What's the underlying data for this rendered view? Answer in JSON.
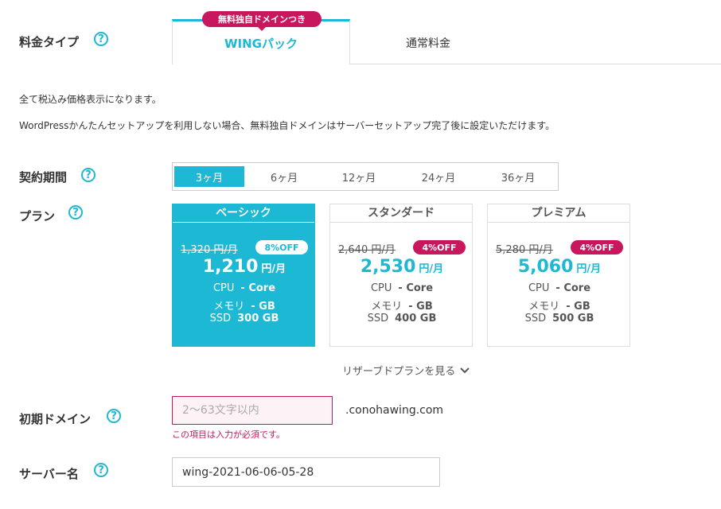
{
  "plan_type": {
    "label": "料金タイプ",
    "help": "?",
    "tabs": [
      {
        "label": "WINGパック",
        "ribbon": "無料独自ドメインつき"
      },
      {
        "label": "通常料金"
      }
    ]
  },
  "notes": [
    "全て税込み価格表示になります。",
    "WordPressかんたんセットアップを利用しない場合、無料独自ドメインはサーバーセットアップ完了後に設定いただけます。"
  ],
  "period": {
    "label": "契約期間",
    "help": "?",
    "options": [
      "3ヶ月",
      "6ヶ月",
      "12ヶ月",
      "24ヶ月",
      "36ヶ月"
    ],
    "selected": "3ヶ月"
  },
  "plans": {
    "label": "プラン",
    "help": "?",
    "items": [
      {
        "name": "ベーシック",
        "original": "1,320 円/月",
        "discount": "8%OFF",
        "price": "1,210",
        "unit": "円/月",
        "cpu": "- Core",
        "memory": "- GB",
        "ssd": "300 GB",
        "selected": true
      },
      {
        "name": "スタンダード",
        "original": "2,640 円/月",
        "discount": "4%OFF",
        "price": "2,530",
        "unit": "円/月",
        "cpu": "- Core",
        "memory": "- GB",
        "ssd": "400 GB"
      },
      {
        "name": "プレミアム",
        "original": "5,280 円/月",
        "discount": "4%OFF",
        "price": "5,060",
        "unit": "円/月",
        "cpu": "- Core",
        "memory": "- GB",
        "ssd": "500 GB"
      }
    ],
    "spec_labels": {
      "cpu": "CPU",
      "memory": "メモリ",
      "ssd": "SSD"
    },
    "reserve_link": "リザーブドプランを見る"
  },
  "domain": {
    "label": "初期ドメイン",
    "help": "?",
    "placeholder": "2～63文字以内",
    "suffix": ".conohawing.com",
    "error": "この項目は入力が必須です。"
  },
  "server": {
    "label": "サーバー名",
    "help": "?",
    "value": "wing-2021-06-06-05-28"
  },
  "colors": {
    "accent": "#1cb8d4",
    "badge": "#c8175d"
  }
}
